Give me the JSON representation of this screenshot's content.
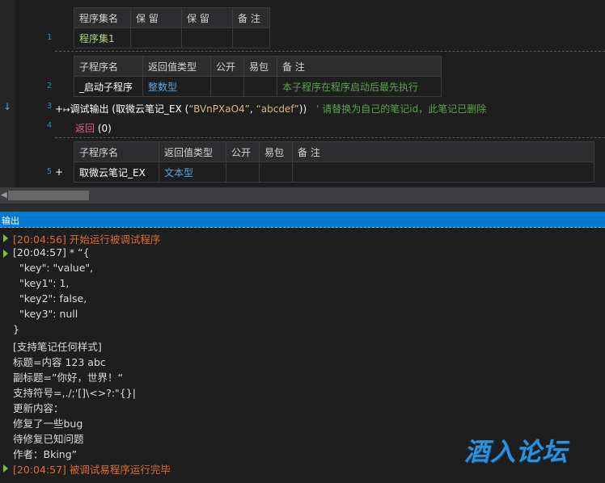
{
  "editor": {
    "line_numbers": [
      "1",
      "2",
      "3",
      "4",
      "5"
    ],
    "assembly_table": {
      "headers": [
        "程序集名",
        "保 留",
        "保 留",
        "备 注"
      ],
      "row": [
        "程序集1",
        "",
        "",
        ""
      ]
    },
    "sub1_table": {
      "headers": [
        "子程序名",
        "返回值类型",
        "公开",
        "易包",
        "备 注"
      ],
      "row": [
        "_启动子程序",
        "整数型",
        "",
        "",
        "本子程序在程序启动后最先执行"
      ]
    },
    "code_line3": {
      "marker": "+",
      "arrows": "↦",
      "call": "调试输出 (取微云笔记_EX (",
      "arg1": "“BVnPXaO4”",
      "comma": ", ",
      "arg2": "“abcdef”",
      "close": "))",
      "comment": "' 请替换为自己的笔记id，此笔记已删除"
    },
    "code_line4": {
      "keyword": "返回",
      "arg": "(0)"
    },
    "sub2_table": {
      "headers": [
        "子程序名",
        "返回值类型",
        "公开",
        "易包",
        "备 注"
      ],
      "row": [
        "取微云笔记_EX",
        "文本型",
        "",
        "",
        ""
      ]
    },
    "line5_marker": "+"
  },
  "scrollbar": {
    "left_arrow": "◀"
  },
  "output_panel": {
    "title": "输出",
    "lines": [
      {
        "text": "[20:04:56] 开始运行被调试程序",
        "color": "orange",
        "marker": true
      },
      {
        "text": "[20:04:57] * “{",
        "color": "default",
        "marker": true
      },
      {
        "text": "  \"key\": \"value\",",
        "color": "default",
        "marker": false
      },
      {
        "text": "  \"key1\": 1,",
        "color": "default",
        "marker": false
      },
      {
        "text": "  \"key2\": false,",
        "color": "default",
        "marker": false
      },
      {
        "text": "  \"key3\": null",
        "color": "default",
        "marker": false
      },
      {
        "text": "}",
        "color": "default",
        "marker": false
      },
      {
        "text": "[支持笔记任何样式]",
        "color": "default",
        "marker": false
      },
      {
        "text": "标题=内容 123 abc",
        "color": "default",
        "marker": false
      },
      {
        "text": "副标题=”你好，世界！“",
        "color": "default",
        "marker": false
      },
      {
        "text": "支持符号=,./;'[]\\<>?:\"{}|",
        "color": "default",
        "marker": false
      },
      {
        "text": "更新内容：",
        "color": "default",
        "marker": false
      },
      {
        "text": "修复了一些bug",
        "color": "default",
        "marker": false
      },
      {
        "text": "待修复已知问题",
        "color": "default",
        "marker": false
      },
      {
        "text": "作者：Bking”",
        "color": "default",
        "marker": false
      },
      {
        "text": "[20:04:57] 被调试易程序运行完毕",
        "color": "orange",
        "marker": true
      }
    ]
  },
  "watermark": "酒入论坛",
  "colors": {
    "accent": "#007acc",
    "orange": "#e06c2c",
    "comment_green": "#57a64a",
    "type_blue": "#5ba3e0"
  }
}
